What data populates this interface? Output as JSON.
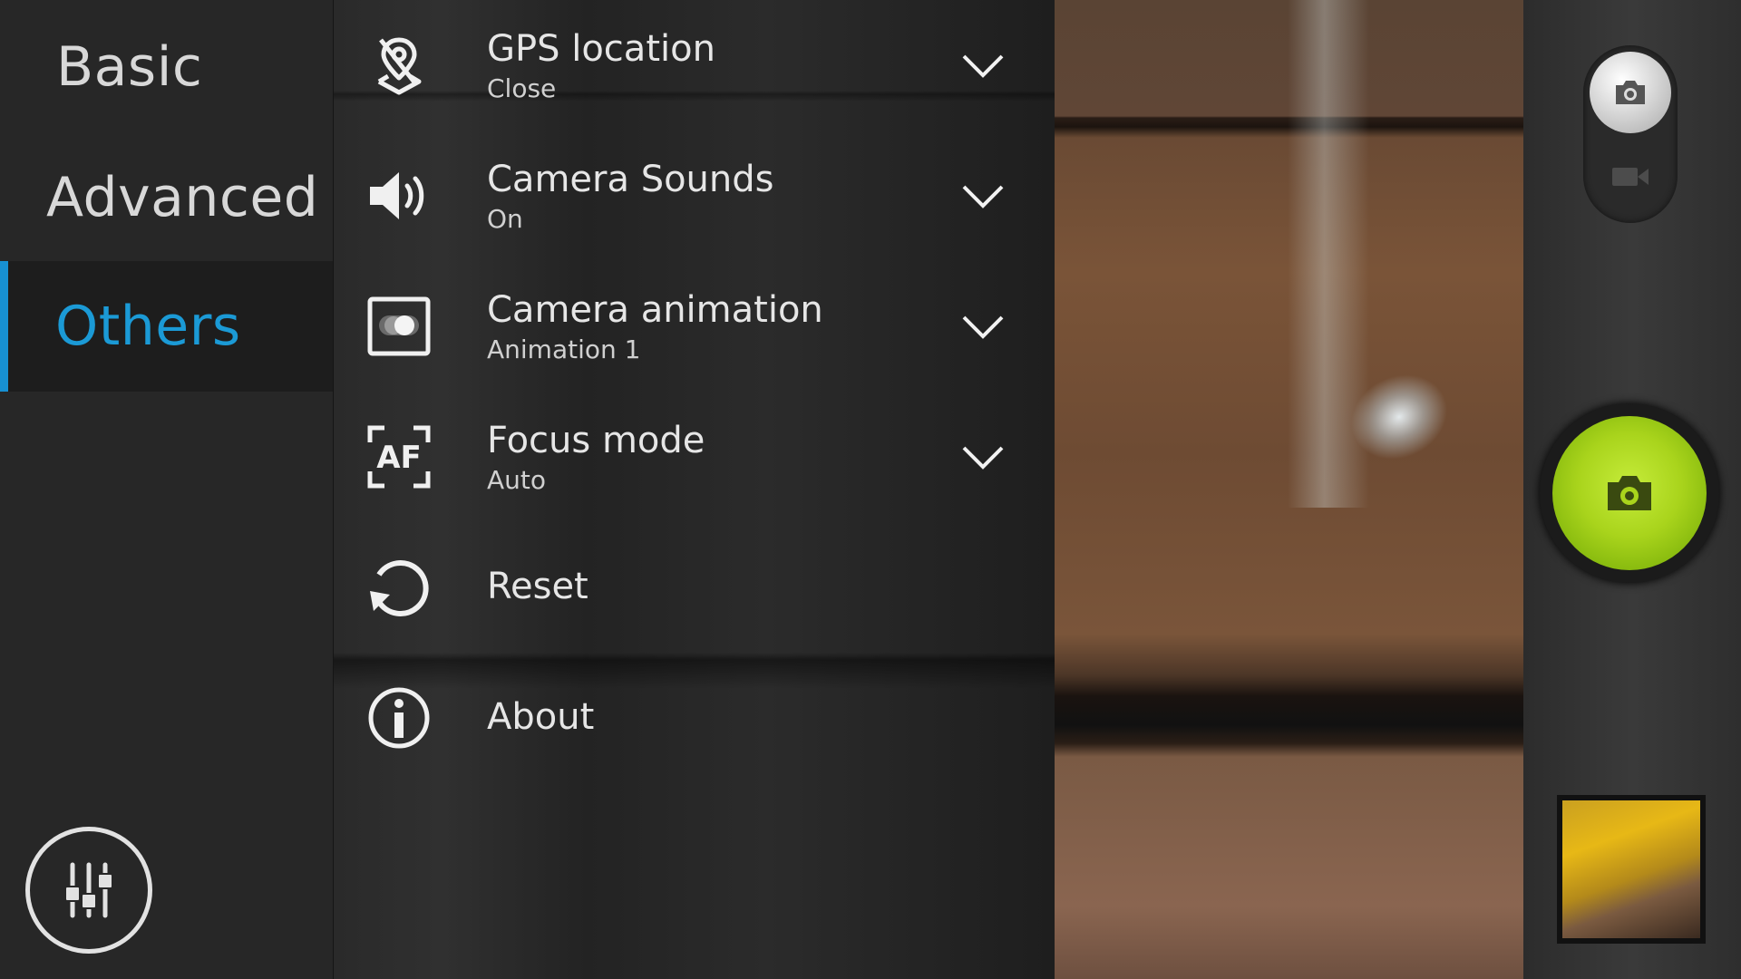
{
  "categories": {
    "basic": "Basic",
    "advanced": "Advanced",
    "others": "Others",
    "selected": "Others"
  },
  "settings": [
    {
      "title": "GPS location",
      "value": "Close",
      "icon": "gps-off-icon"
    },
    {
      "title": "Camera Sounds",
      "value": "On",
      "icon": "speaker-icon"
    },
    {
      "title": "Camera animation",
      "value": "Animation 1",
      "icon": "animation-toggle-icon"
    },
    {
      "title": "Focus mode",
      "value": "Auto",
      "icon": "af-focus-icon"
    },
    {
      "title": "Reset",
      "icon": "reset-icon"
    },
    {
      "title": "About",
      "icon": "info-icon"
    }
  ],
  "controls": {
    "equalizer_icon": "sliders-icon",
    "photo_mode_icon": "camera-icon",
    "video_mode_icon": "video-camera-icon",
    "shutter_icon": "camera-icon"
  },
  "colors": {
    "accent": "#1b9ad6",
    "shutter": "#a9d41c"
  }
}
